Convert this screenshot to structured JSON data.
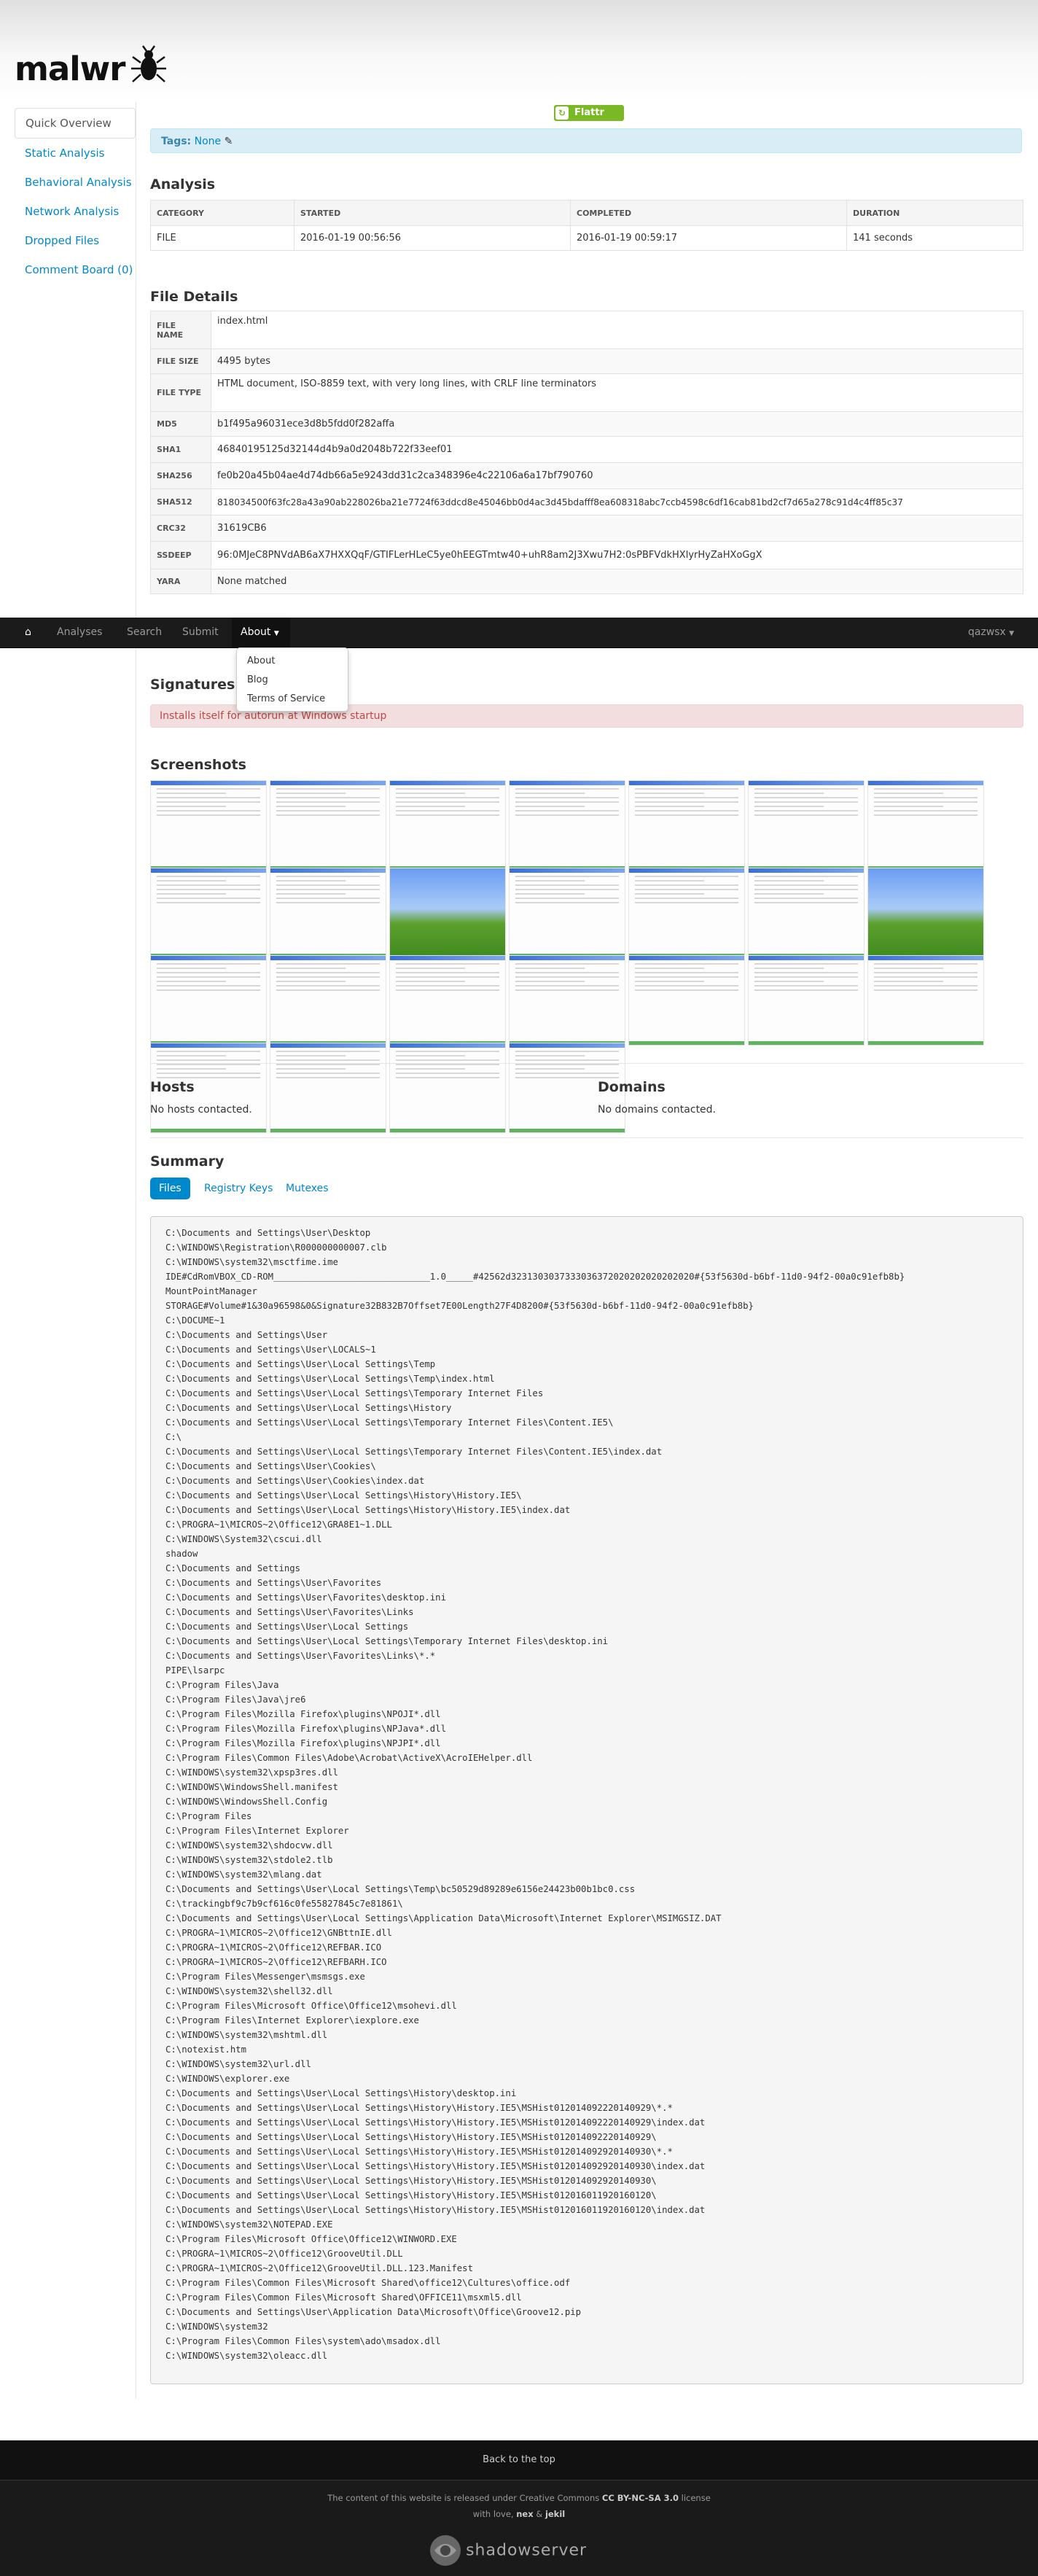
{
  "brand": {
    "logo_text": "malwr"
  },
  "sidebar": {
    "items": [
      {
        "label": "Quick Overview",
        "active": true
      },
      {
        "label": "Static Analysis"
      },
      {
        "label": "Behavioral Analysis"
      },
      {
        "label": "Network Analysis"
      },
      {
        "label": "Dropped Files"
      },
      {
        "label": "Comment Board (0)"
      }
    ]
  },
  "flattr": {
    "label": "Flattr"
  },
  "tags": {
    "label": "Tags:",
    "value": "None"
  },
  "analysis": {
    "title": "Analysis",
    "headers": [
      "CATEGORY",
      "STARTED",
      "COMPLETED",
      "DURATION"
    ],
    "row": [
      "FILE",
      "2016-01-19 00:56:56",
      "2016-01-19 00:59:17",
      "141 seconds"
    ]
  },
  "file_details": {
    "title": "File Details",
    "rows": [
      {
        "k": "FILE NAME",
        "v": "index.html"
      },
      {
        "k": "FILE SIZE",
        "v": "4495 bytes"
      },
      {
        "k": "FILE TYPE",
        "v": "HTML document, ISO-8859 text, with very long lines, with CRLF line terminators"
      },
      {
        "k": "MD5",
        "v": "b1f495a96031ece3d8b5fdd0f282affa"
      },
      {
        "k": "SHA1",
        "v": "46840195125d32144d4b9a0d2048b722f33eef01"
      },
      {
        "k": "SHA256",
        "v": "fe0b20a45b04ae4d74db66a5e9243dd31c2ca348396e4c22106a6a17bf790760"
      },
      {
        "k": "SHA512",
        "v": "818034500f63fc28a43a90ab228026ba21e7724f63ddcd8e45046bb0d4ac3d45bdafff8ea608318abc7ccb4598c6df16cab81bd2cf7d65a278c91d4c4ff85c37"
      },
      {
        "k": "CRC32",
        "v": "31619CB6"
      },
      {
        "k": "SSDEEP",
        "v": "96:0MJeC8PNVdAB6aX7HXXQqF/GTIFLerHLeC5ye0hEEGTmtw40+uhR8am2J3Xwu7H2:0sPBFVdkHXlyrHyZaHXoGgX"
      },
      {
        "k": "YARA",
        "v": "None matched"
      }
    ]
  },
  "navbar": {
    "items": [
      "Analyses",
      "Search",
      "Submit",
      "About"
    ],
    "user": "qazwsx"
  },
  "about_menu": [
    "About",
    "Blog",
    "Terms of Service"
  ],
  "signatures": {
    "title": "Signatures",
    "alert": "Installs itself for autorun at Windows startup"
  },
  "screenshots": {
    "title": "Screenshots",
    "count": 25
  },
  "hosts": {
    "title": "Hosts",
    "text": "No hosts contacted."
  },
  "domains": {
    "title": "Domains",
    "text": "No domains contacted."
  },
  "summary": {
    "title": "Summary",
    "tabs": [
      "Files",
      "Registry Keys",
      "Mutexes"
    ],
    "files": [
      "C:\\Documents and Settings\\User\\Desktop",
      "C:\\WINDOWS\\Registration\\R000000000007.clb",
      "C:\\WINDOWS\\system32\\msctfime.ime",
      "IDE#CdRomVBOX_CD-ROM_____________________________1.0_____#42562d3231303037333036372020202020202020#{53f5630d-b6bf-11d0-94f2-00a0c91efb8b}",
      "MountPointManager",
      "STORAGE#Volume#1&30a96598&0&Signature32B832B7Offset7E00Length27F4D8200#{53f5630d-b6bf-11d0-94f2-00a0c91efb8b}",
      "C:\\DOCUME~1",
      "C:\\Documents and Settings\\User",
      "C:\\Documents and Settings\\User\\LOCALS~1",
      "C:\\Documents and Settings\\User\\Local Settings\\Temp",
      "C:\\Documents and Settings\\User\\Local Settings\\Temp\\index.html",
      "C:\\Documents and Settings\\User\\Local Settings\\Temporary Internet Files",
      "C:\\Documents and Settings\\User\\Local Settings\\History",
      "C:\\Documents and Settings\\User\\Local Settings\\Temporary Internet Files\\Content.IE5\\",
      "C:\\",
      "C:\\Documents and Settings\\User\\Local Settings\\Temporary Internet Files\\Content.IE5\\index.dat",
      "C:\\Documents and Settings\\User\\Cookies\\",
      "C:\\Documents and Settings\\User\\Cookies\\index.dat",
      "C:\\Documents and Settings\\User\\Local Settings\\History\\History.IE5\\",
      "C:\\Documents and Settings\\User\\Local Settings\\History\\History.IE5\\index.dat",
      "C:\\PROGRA~1\\MICROS~2\\Office12\\GRA8E1~1.DLL",
      "C:\\WINDOWS\\System32\\cscui.dll",
      "shadow",
      "C:\\Documents and Settings",
      "C:\\Documents and Settings\\User\\Favorites",
      "C:\\Documents and Settings\\User\\Favorites\\desktop.ini",
      "C:\\Documents and Settings\\User\\Favorites\\Links",
      "C:\\Documents and Settings\\User\\Local Settings",
      "C:\\Documents and Settings\\User\\Local Settings\\Temporary Internet Files\\desktop.ini",
      "C:\\Documents and Settings\\User\\Favorites\\Links\\*.*",
      "PIPE\\lsarpc",
      "C:\\Program Files\\Java",
      "C:\\Program Files\\Java\\jre6",
      "C:\\Program Files\\Mozilla Firefox\\plugins\\NPOJI*.dll",
      "C:\\Program Files\\Mozilla Firefox\\plugins\\NPJava*.dll",
      "C:\\Program Files\\Mozilla Firefox\\plugins\\NPJPI*.dll",
      "C:\\Program Files\\Common Files\\Adobe\\Acrobat\\ActiveX\\AcroIEHelper.dll",
      "C:\\WINDOWS\\system32\\xpsp3res.dll",
      "C:\\WINDOWS\\WindowsShell.manifest",
      "C:\\WINDOWS\\WindowsShell.Config",
      "C:\\Program Files",
      "C:\\Program Files\\Internet Explorer",
      "C:\\WINDOWS\\system32\\shdocvw.dll",
      "C:\\WINDOWS\\system32\\stdole2.tlb",
      "C:\\WINDOWS\\system32\\mlang.dat",
      "C:\\Documents and Settings\\User\\Local Settings\\Temp\\bc50529d89289e6156e24423b00b1bc0.css",
      "C:\\trackingbf9c7b9cf616c0fe55827845c7e81861\\",
      "C:\\Documents and Settings\\User\\Local Settings\\Application Data\\Microsoft\\Internet Explorer\\MSIMGSIZ.DAT",
      "C:\\PROGRA~1\\MICROS~2\\Office12\\GNBttnIE.dll",
      "C:\\PROGRA~1\\MICROS~2\\Office12\\REFBAR.ICO",
      "C:\\PROGRA~1\\MICROS~2\\Office12\\REFBARH.ICO",
      "C:\\Program Files\\Messenger\\msmsgs.exe",
      "C:\\WINDOWS\\system32\\shell32.dll",
      "C:\\Program Files\\Microsoft Office\\Office12\\msohevi.dll",
      "C:\\Program Files\\Internet Explorer\\iexplore.exe",
      "C:\\WINDOWS\\system32\\mshtml.dll",
      "C:\\notexist.htm",
      "C:\\WINDOWS\\system32\\url.dll",
      "C:\\WINDOWS\\explorer.exe",
      "C:\\Documents and Settings\\User\\Local Settings\\History\\desktop.ini",
      "C:\\Documents and Settings\\User\\Local Settings\\History\\History.IE5\\MSHist012014092220140929\\*.*",
      "C:\\Documents and Settings\\User\\Local Settings\\History\\History.IE5\\MSHist012014092220140929\\index.dat",
      "C:\\Documents and Settings\\User\\Local Settings\\History\\History.IE5\\MSHist012014092220140929\\",
      "C:\\Documents and Settings\\User\\Local Settings\\History\\History.IE5\\MSHist012014092920140930\\*.*",
      "C:\\Documents and Settings\\User\\Local Settings\\History\\History.IE5\\MSHist012014092920140930\\index.dat",
      "C:\\Documents and Settings\\User\\Local Settings\\History\\History.IE5\\MSHist012014092920140930\\",
      "C:\\Documents and Settings\\User\\Local Settings\\History\\History.IE5\\MSHist012016011920160120\\",
      "C:\\Documents and Settings\\User\\Local Settings\\History\\History.IE5\\MSHist012016011920160120\\index.dat",
      "C:\\WINDOWS\\system32\\NOTEPAD.EXE",
      "C:\\Program Files\\Microsoft Office\\Office12\\WINWORD.EXE",
      "C:\\PROGRA~1\\MICROS~2\\Office12\\GrooveUtil.DLL",
      "C:\\PROGRA~1\\MICROS~2\\Office12\\GrooveUtil.DLL.123.Manifest",
      "C:\\Program Files\\Common Files\\Microsoft Shared\\office12\\Cultures\\office.odf",
      "C:\\Program Files\\Common Files\\Microsoft Shared\\OFFICE11\\msxml5.dll",
      "C:\\Documents and Settings\\User\\Application Data\\Microsoft\\Office\\Groove12.pip",
      "C:\\WINDOWS\\system32",
      "C:\\Program Files\\Common Files\\system\\ado\\msadox.dll",
      "C:\\WINDOWS\\system32\\oleacc.dll"
    ]
  },
  "footer": {
    "back_to_top": "Back to the top",
    "license_pre": "The content of this website is released under Creative Commons",
    "license_name": "CC BY-NC-SA 3.0",
    "license_post": "license",
    "with_love": "with love,",
    "author1": "nex",
    "amp": "&",
    "author2": "jekil",
    "sponsor": "shadowserver"
  }
}
